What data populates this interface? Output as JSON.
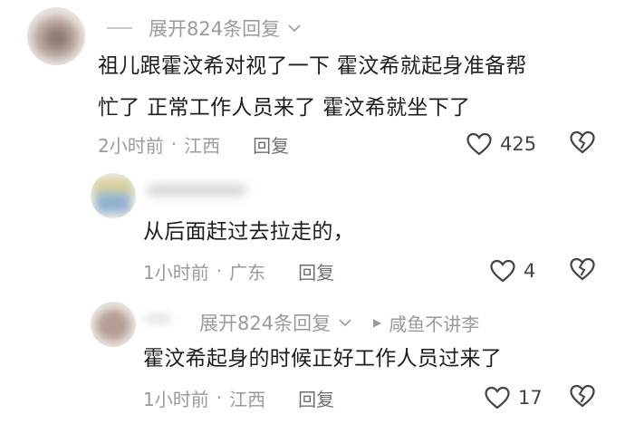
{
  "comments": [
    {
      "expand_label": "展开824条回复",
      "text_line1": "祖儿跟霍汶希对视了一下 霍汶希就起身准备帮",
      "text_line2": "忙了 正常工作人员来了 霍汶希就坐下了",
      "time": "2小时前",
      "separator": "·",
      "location": "江西",
      "reply_label": "回复",
      "likes": "425"
    },
    {
      "text": "从后面赶过去拉走的，",
      "time": "1小时前",
      "separator": "·",
      "location": "广东",
      "reply_label": "回复",
      "likes": "4"
    },
    {
      "expand_label": "展开824条回复",
      "reply_to": "咸鱼不讲李",
      "text": "霍汶希起身的时候正好工作人员过来了",
      "time": "1小时前",
      "separator": "·",
      "location": "江西",
      "reply_label": "回复",
      "likes": "17"
    }
  ],
  "icons": {
    "like": "heart-outline-icon",
    "dislike": "broken-heart-icon",
    "expand": "chevron-down-icon",
    "reply_to": "play-triangle-icon"
  },
  "colors": {
    "text_primary": "#1d1d1d",
    "text_meta": "#9b9b9b"
  }
}
